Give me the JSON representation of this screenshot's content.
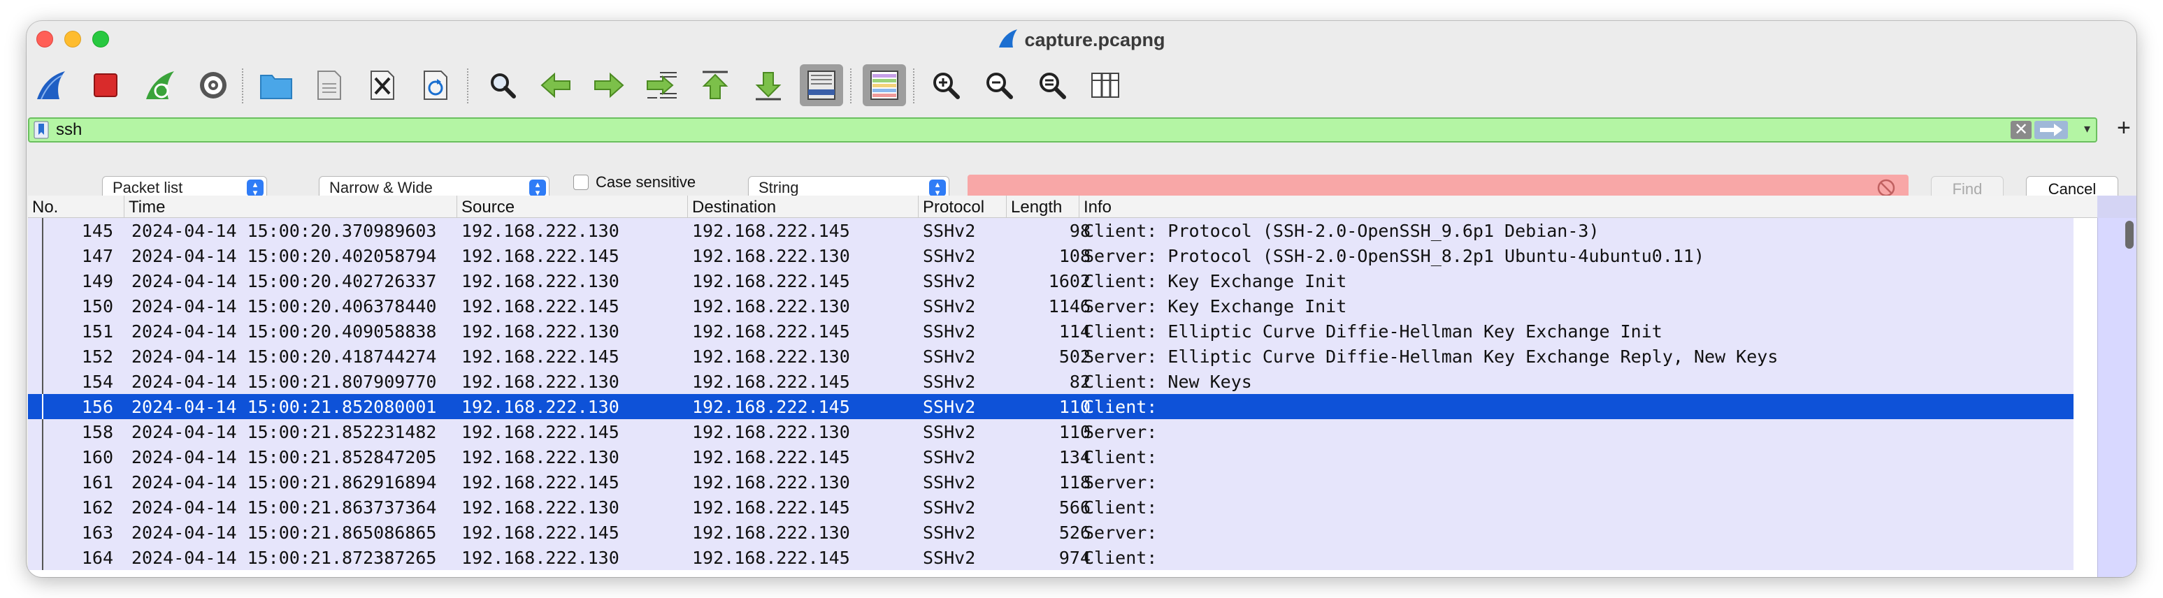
{
  "window": {
    "title": "capture.pcapng"
  },
  "toolbar": {
    "buttons": [
      {
        "icon": "start-capture-icon",
        "label": "Start capturing packets"
      },
      {
        "icon": "stop-capture-icon",
        "label": "Stop capturing packets"
      },
      {
        "icon": "restart-capture-icon",
        "label": "Restart current capture"
      },
      {
        "icon": "capture-options-icon",
        "label": "Capture options"
      },
      {
        "icon": "open-file-icon",
        "label": "Open"
      },
      {
        "icon": "save-file-icon",
        "label": "Save"
      },
      {
        "icon": "close-file-icon",
        "label": "Close"
      },
      {
        "icon": "reload-file-icon",
        "label": "Reload"
      },
      {
        "icon": "find-packet-icon",
        "label": "Find packet"
      },
      {
        "icon": "go-back-icon",
        "label": "Go back"
      },
      {
        "icon": "go-forward-icon",
        "label": "Go forward"
      },
      {
        "icon": "go-to-packet-icon",
        "label": "Go to packet"
      },
      {
        "icon": "go-first-icon",
        "label": "First packet"
      },
      {
        "icon": "go-last-icon",
        "label": "Last packet"
      },
      {
        "icon": "auto-scroll-icon",
        "label": "Auto scroll"
      },
      {
        "icon": "colorize-icon",
        "label": "Colorize"
      },
      {
        "icon": "zoom-in-icon",
        "label": "Zoom in"
      },
      {
        "icon": "zoom-out-icon",
        "label": "Zoom out"
      },
      {
        "icon": "zoom-normal-icon",
        "label": "Normal size"
      },
      {
        "icon": "resize-columns-icon",
        "label": "Resize columns"
      }
    ]
  },
  "filter": {
    "value": "ssh",
    "clear_icon": "clear-filter-icon",
    "apply_icon": "apply-filter-icon",
    "add_label": "+"
  },
  "findbar": {
    "search_in": "Packet list",
    "char_width": "Narrow & Wide",
    "case_sensitive_label": "Case sensitive",
    "case_sensitive": false,
    "search_type": "String",
    "search_value": "",
    "find_label": "Find",
    "cancel_label": "Cancel"
  },
  "columns": [
    "No.",
    "Time",
    "Source",
    "Destination",
    "Protocol",
    "Length",
    "Info"
  ],
  "packets": [
    {
      "no": "145",
      "time": "2024-04-14 15:00:20.370989603",
      "src": "192.168.222.130",
      "dst": "192.168.222.145",
      "proto": "SSHv2",
      "len": "98",
      "info": "Client: Protocol (SSH-2.0-OpenSSH_9.6p1 Debian-3)"
    },
    {
      "no": "147",
      "time": "2024-04-14 15:00:20.402058794",
      "src": "192.168.222.145",
      "dst": "192.168.222.130",
      "proto": "SSHv2",
      "len": "108",
      "info": "Server: Protocol (SSH-2.0-OpenSSH_8.2p1 Ubuntu-4ubuntu0.11)"
    },
    {
      "no": "149",
      "time": "2024-04-14 15:00:20.402726337",
      "src": "192.168.222.130",
      "dst": "192.168.222.145",
      "proto": "SSHv2",
      "len": "1602",
      "info": "Client: Key Exchange Init"
    },
    {
      "no": "150",
      "time": "2024-04-14 15:00:20.406378440",
      "src": "192.168.222.145",
      "dst": "192.168.222.130",
      "proto": "SSHv2",
      "len": "1146",
      "info": "Server: Key Exchange Init"
    },
    {
      "no": "151",
      "time": "2024-04-14 15:00:20.409058838",
      "src": "192.168.222.130",
      "dst": "192.168.222.145",
      "proto": "SSHv2",
      "len": "114",
      "info": "Client: Elliptic Curve Diffie-Hellman Key Exchange Init"
    },
    {
      "no": "152",
      "time": "2024-04-14 15:00:20.418744274",
      "src": "192.168.222.145",
      "dst": "192.168.222.130",
      "proto": "SSHv2",
      "len": "502",
      "info": "Server: Elliptic Curve Diffie-Hellman Key Exchange Reply, New Keys"
    },
    {
      "no": "154",
      "time": "2024-04-14 15:00:21.807909770",
      "src": "192.168.222.130",
      "dst": "192.168.222.145",
      "proto": "SSHv2",
      "len": "82",
      "info": "Client: New Keys"
    },
    {
      "no": "156",
      "time": "2024-04-14 15:00:21.852080001",
      "src": "192.168.222.130",
      "dst": "192.168.222.145",
      "proto": "SSHv2",
      "len": "110",
      "info": "Client:",
      "selected": true
    },
    {
      "no": "158",
      "time": "2024-04-14 15:00:21.852231482",
      "src": "192.168.222.145",
      "dst": "192.168.222.130",
      "proto": "SSHv2",
      "len": "110",
      "info": "Server:"
    },
    {
      "no": "160",
      "time": "2024-04-14 15:00:21.852847205",
      "src": "192.168.222.130",
      "dst": "192.168.222.145",
      "proto": "SSHv2",
      "len": "134",
      "info": "Client:"
    },
    {
      "no": "161",
      "time": "2024-04-14 15:00:21.862916894",
      "src": "192.168.222.145",
      "dst": "192.168.222.130",
      "proto": "SSHv2",
      "len": "118",
      "info": "Server:"
    },
    {
      "no": "162",
      "time": "2024-04-14 15:00:21.863737364",
      "src": "192.168.222.130",
      "dst": "192.168.222.145",
      "proto": "SSHv2",
      "len": "566",
      "info": "Client:"
    },
    {
      "no": "163",
      "time": "2024-04-14 15:00:21.865086865",
      "src": "192.168.222.145",
      "dst": "192.168.222.130",
      "proto": "SSHv2",
      "len": "526",
      "info": "Server:"
    },
    {
      "no": "164",
      "time": "2024-04-14 15:00:21.872387265",
      "src": "192.168.222.130",
      "dst": "192.168.222.145",
      "proto": "SSHv2",
      "len": "974",
      "info": "Client:"
    }
  ],
  "colors": {
    "row_bg": "#e6e5fb",
    "selected_bg": "#0e52d8",
    "filter_valid_bg": "#b4f5a4",
    "find_invalid_bg": "#f8a7a7"
  }
}
